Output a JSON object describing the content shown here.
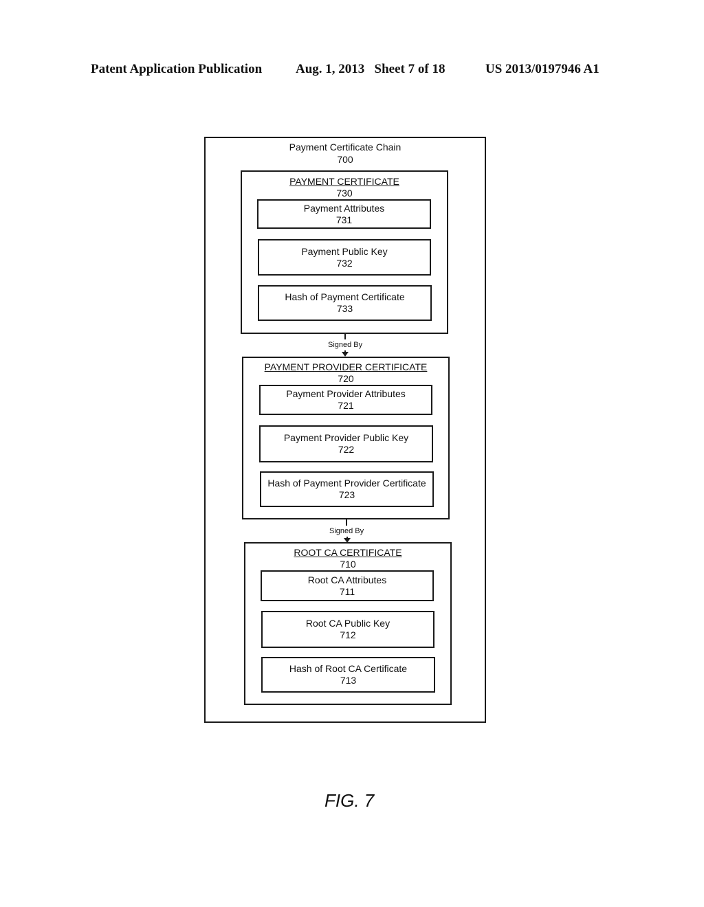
{
  "header": {
    "publication": "Patent Application Publication",
    "date_sheet": "Aug. 1, 2013   Sheet 7 of 18",
    "patent_number": "US 2013/0197946 A1"
  },
  "chain": {
    "title": "Payment Certificate Chain",
    "ref": "700",
    "certificates": [
      {
        "title": "PAYMENT CERTIFICATE",
        "ref": "730",
        "fields": [
          {
            "label": "Payment Attributes",
            "ref": "731"
          },
          {
            "label": "Payment Public Key",
            "ref": "732"
          },
          {
            "label": "Hash of Payment Certificate",
            "ref": "733"
          }
        ]
      },
      {
        "title": "PAYMENT PROVIDER CERTIFICATE",
        "ref": "720",
        "fields": [
          {
            "label": "Payment Provider Attributes",
            "ref": "721"
          },
          {
            "label": "Payment Provider Public Key",
            "ref": "722"
          },
          {
            "label": "Hash of Payment Provider Certificate",
            "ref": "723"
          }
        ]
      },
      {
        "title": "ROOT CA CERTIFICATE",
        "ref": "710",
        "fields": [
          {
            "label": "Root CA Attributes",
            "ref": "711"
          },
          {
            "label": "Root CA Public Key",
            "ref": "712"
          },
          {
            "label": "Hash of Root CA Certificate",
            "ref": "713"
          }
        ]
      }
    ],
    "connectors": [
      {
        "label": "Signed By"
      },
      {
        "label": "Signed By"
      }
    ]
  },
  "figure_label": "FIG. 7"
}
